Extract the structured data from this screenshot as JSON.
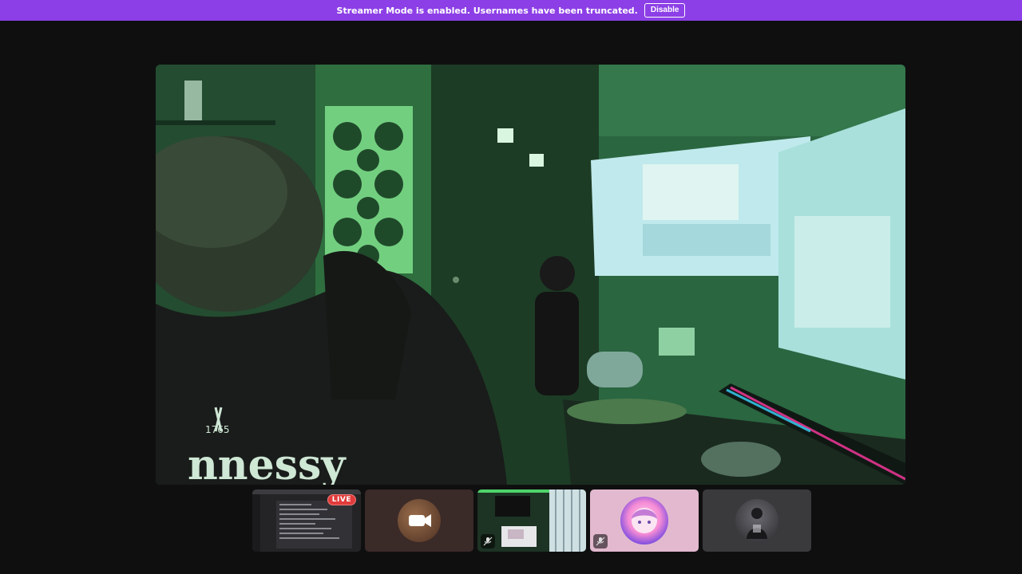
{
  "banner": {
    "message": "Streamer Mode is enabled. Usernames have been truncated.",
    "disable_label": "Disable",
    "color": "#8c3fe6"
  },
  "stage": {
    "shirt_text": "nnessy",
    "shirt_logo_text": "1765"
  },
  "tiles": [
    {
      "kind": "screen-share",
      "badge": "LIVE",
      "icon": "screen-share-icon"
    },
    {
      "kind": "camera-off",
      "icon": "video-camera-icon"
    },
    {
      "kind": "room-camera",
      "icon": "muted-mic-icon"
    },
    {
      "kind": "avatar-pink",
      "icon": "muted-mic-icon"
    },
    {
      "kind": "avatar-grey",
      "icon": "user-avatar"
    }
  ],
  "colors": {
    "background": "#0f0f10",
    "live": "#e23b3b",
    "room_green": "#2f6a3f"
  }
}
